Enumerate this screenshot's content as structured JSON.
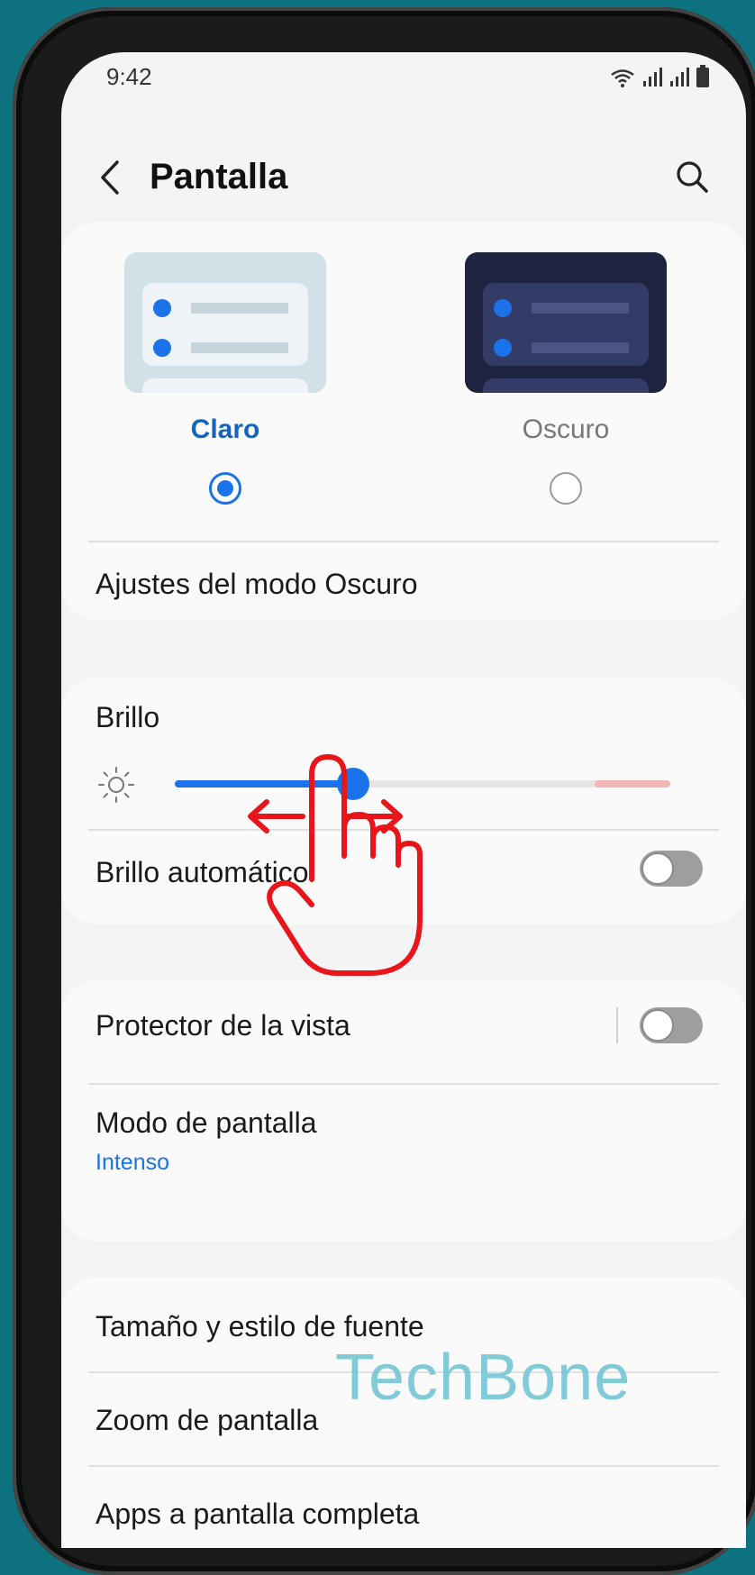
{
  "status_bar": {
    "time": "9:42",
    "icons": [
      "wifi-icon",
      "signal-icon",
      "signal-icon",
      "battery-icon"
    ]
  },
  "header": {
    "title": "Pantalla",
    "back_icon": "chevron-left-icon",
    "search_icon": "search-icon"
  },
  "theme": {
    "light_label": "Claro",
    "dark_label": "Oscuro",
    "selected": "light",
    "dark_mode_settings": "Ajustes del modo Oscuro"
  },
  "brightness": {
    "label": "Brillo",
    "icon": "sun-icon",
    "value_fraction": 0.36,
    "auto_label": "Brillo automático",
    "auto_on": false
  },
  "eye_comfort": {
    "label": "Protector de la vista",
    "on": false
  },
  "screen_mode": {
    "label": "Modo de pantalla",
    "value": "Intenso"
  },
  "font_section": {
    "items": [
      "Tamaño y estilo de fuente",
      "Zoom de pantalla",
      "Apps a pantalla completa"
    ]
  },
  "overlay": {
    "gesture_icon": "swipe-hand-icon",
    "watermark": "TechBone"
  },
  "colors": {
    "accent": "#1a73e8",
    "gesture": "#e8151b",
    "watermark": "#75c7d6"
  }
}
